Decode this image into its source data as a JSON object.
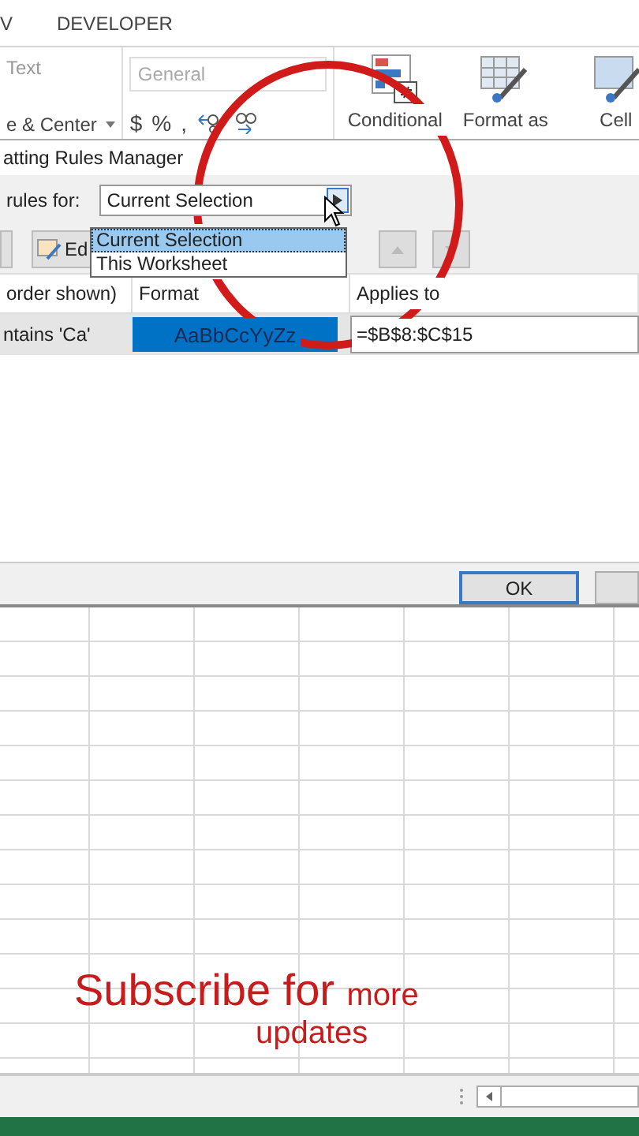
{
  "ribbon_tabs": [
    {
      "label": "V"
    },
    {
      "label": "DEVELOPER"
    }
  ],
  "ribbon": {
    "alignment_items": [
      "Text",
      "e & Center"
    ],
    "number_format": {
      "value": "General"
    },
    "number_buttons": [
      "$",
      "%",
      ","
    ],
    "styles": [
      {
        "kind": "conditional",
        "label": "Conditional"
      },
      {
        "kind": "table",
        "label": "Format as"
      },
      {
        "kind": "cell",
        "label": "Cell"
      }
    ]
  },
  "dialog": {
    "title": "atting Rules Manager",
    "show_label": "rules for:",
    "scope_dropdown": {
      "value": "Current Selection",
      "options": [
        {
          "label": "Current Selection",
          "selected": true
        },
        {
          "label": "This Worksheet",
          "selected": false
        }
      ]
    },
    "edit_button": "Ed",
    "columns": [
      "order shown)",
      "Format",
      "Applies to"
    ],
    "rules": [
      {
        "rule": "ntains 'Ca'",
        "format_preview": "AaBbCcYyZz",
        "applies_to": "=$B$8:$C$15"
      }
    ],
    "buttons": [
      "OK"
    ]
  },
  "caption": {
    "line1": "Subscribe for",
    "line1_small": "more",
    "line2": "updates"
  }
}
